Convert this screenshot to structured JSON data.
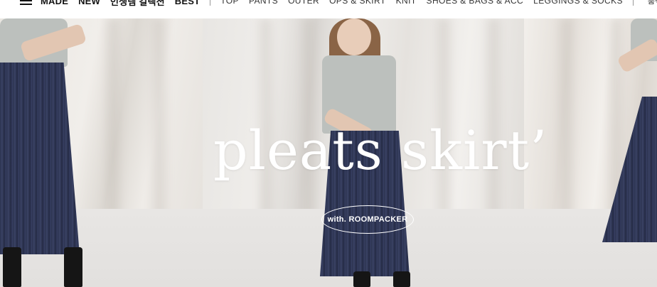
{
  "nav": {
    "menu_icon": "hamburger-icon",
    "primary": [
      {
        "label": "MADE"
      },
      {
        "label": "NEW"
      },
      {
        "label": "인생템 컬렉션"
      },
      {
        "label": "BEST"
      }
    ],
    "categories": [
      {
        "label": "TOP"
      },
      {
        "label": "PANTS"
      },
      {
        "label": "OUTER"
      },
      {
        "label": "OPS & SKIRT"
      },
      {
        "label": "KNIT"
      },
      {
        "label": "SHOES & BAGS & ACC"
      },
      {
        "label": "LEGGINGS & SOCKS"
      }
    ],
    "right_label": "룸팩커스"
  },
  "hero": {
    "headline": "pleats skirt’",
    "badge": "with. ROOMPACKER"
  }
}
